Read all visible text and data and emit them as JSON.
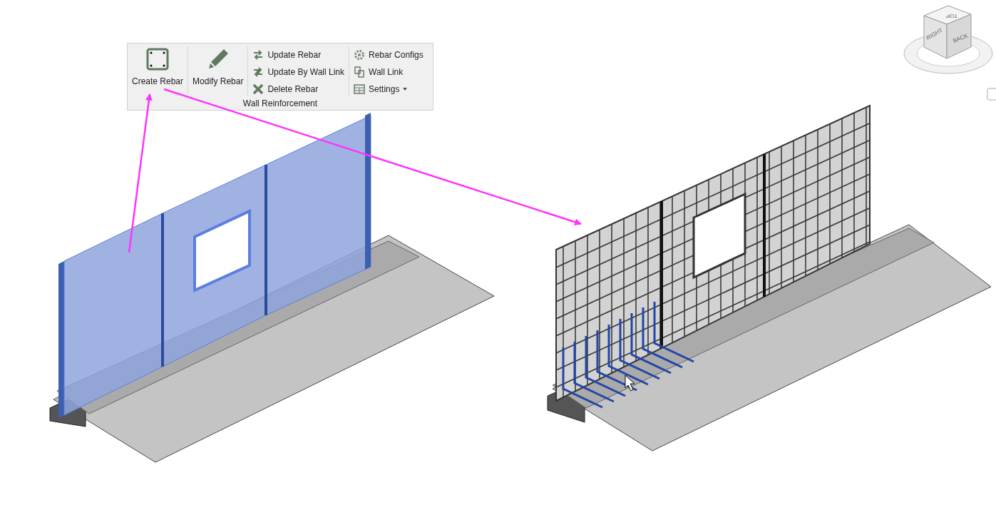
{
  "ribbon": {
    "panel_title": "Wall Reinforcement",
    "large_buttons": [
      {
        "label": "Create Rebar"
      },
      {
        "label": "Modify Rebar"
      }
    ],
    "columns": [
      [
        {
          "label": "Update Rebar"
        },
        {
          "label": "Update By Wall Link"
        },
        {
          "label": "Delete Rebar"
        }
      ],
      [
        {
          "label": "Rebar Configs"
        },
        {
          "label": "Wall Link"
        },
        {
          "label": "Settings",
          "dropdown": true
        }
      ]
    ]
  },
  "view_cube": {
    "faces": [
      "TOP",
      "RIGHT",
      "BACK"
    ]
  }
}
